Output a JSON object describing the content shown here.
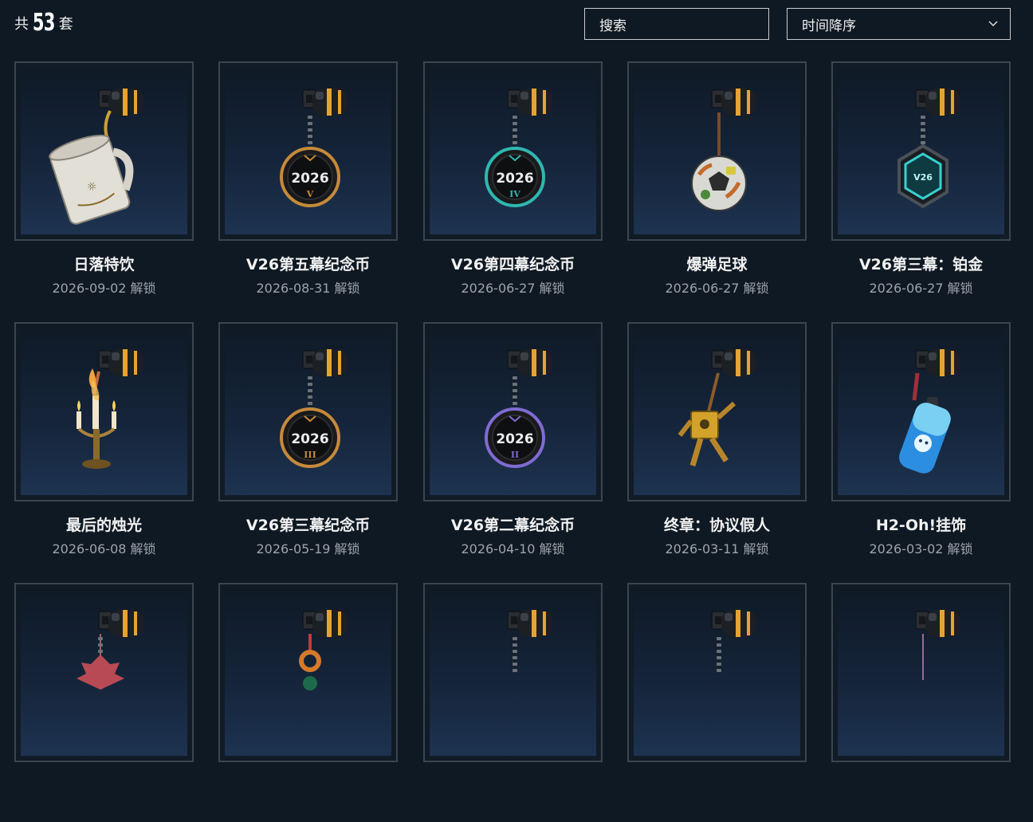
{
  "header": {
    "count_prefix": "共",
    "count_value": "53",
    "count_suffix": "套",
    "search_placeholder": "搜索",
    "sort_selected": "时间降序"
  },
  "items": [
    {
      "title": "日落特饮",
      "date": "2026-09-02 解锁",
      "icon": "mug-charm-icon"
    },
    {
      "title": "V26第五幕纪念币",
      "date": "2026-08-31 解锁",
      "icon": "coin-charm-icon",
      "coin_text": "2026",
      "coin_roman": "V",
      "accent": "#c58a3a"
    },
    {
      "title": "V26第四幕纪念币",
      "date": "2026-06-27 解锁",
      "icon": "coin-charm-icon",
      "coin_text": "2026",
      "coin_roman": "IV",
      "accent": "#2fb7b0"
    },
    {
      "title": "爆弹足球",
      "date": "2026-06-27 解锁",
      "icon": "soccer-ball-charm-icon"
    },
    {
      "title": "V26第三幕：铂金",
      "date": "2026-06-27 解锁",
      "icon": "platinum-badge-charm-icon",
      "coin_text": "V26"
    },
    {
      "title": "最后的烛光",
      "date": "2026-06-08 解锁",
      "icon": "candelabra-charm-icon"
    },
    {
      "title": "V26第三幕纪念币",
      "date": "2026-05-19 解锁",
      "icon": "coin-charm-icon",
      "coin_text": "2026",
      "coin_roman": "III",
      "accent": "#c58a3a"
    },
    {
      "title": "V26第二幕纪念币",
      "date": "2026-04-10 解锁",
      "icon": "coin-charm-icon",
      "coin_text": "2026",
      "coin_roman": "II",
      "accent": "#7f6bd1"
    },
    {
      "title": "终章：协议假人",
      "date": "2026-03-11 解锁",
      "icon": "robot-dummy-charm-icon"
    },
    {
      "title": "H2-Oh!挂饰",
      "date": "2026-03-02 解锁",
      "icon": "water-bottle-charm-icon"
    },
    {
      "title": "",
      "date": "",
      "icon": "maple-leaf-charm-icon"
    },
    {
      "title": "",
      "date": "",
      "icon": "ring-charm-icon"
    },
    {
      "title": "",
      "date": "",
      "icon": "plate-charm-icon"
    },
    {
      "title": "",
      "date": "",
      "icon": "tag-charm-icon"
    },
    {
      "title": "",
      "date": "",
      "icon": "string-charm-icon"
    }
  ]
}
